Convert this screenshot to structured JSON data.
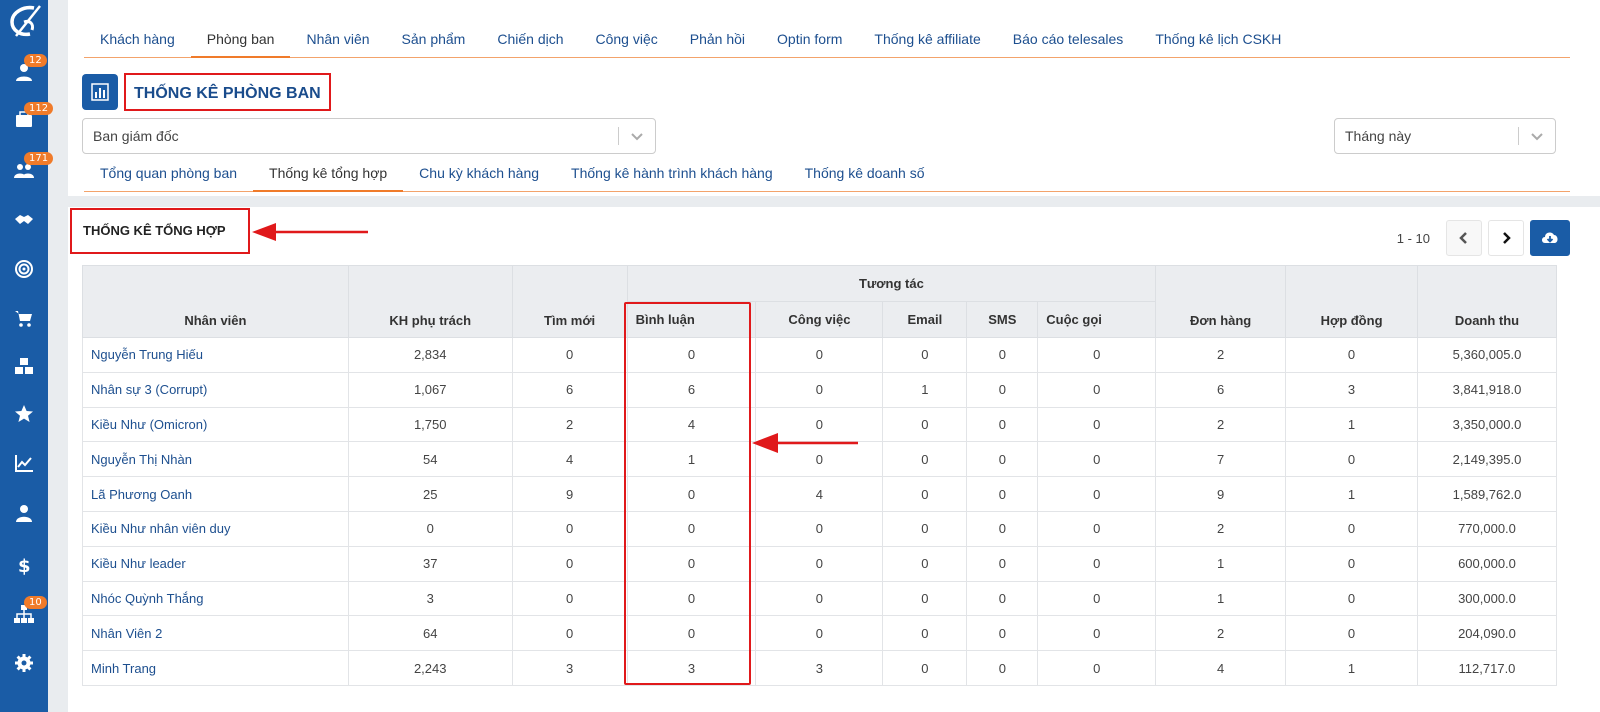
{
  "sidebar": {
    "badges": {
      "contacts": "12",
      "inbox": "112",
      "groups": "171",
      "org": "10"
    }
  },
  "tabs": [
    "Khách hàng",
    "Phòng ban",
    "Nhân viên",
    "Sản phẩm",
    "Chiến dịch",
    "Công việc",
    "Phản hồi",
    "Optin form",
    "Thống kê affiliate",
    "Báo cáo telesales",
    "Thống kê lịch CSKH"
  ],
  "active_tab": 1,
  "page_title": "THỐNG KÊ PHÒNG BAN",
  "department_select": "Ban giám đốc",
  "period_select": "Tháng này",
  "subtabs": [
    "Tổng quan phòng ban",
    "Thống kê tổng hợp",
    "Chu kỳ khách hàng",
    "Thống kê hành trình khách hàng",
    "Thống kê doanh số"
  ],
  "active_subtab": 1,
  "section_title": "THỐNG KÊ TỔNG HỢP",
  "pager": {
    "range": "1 - 10"
  },
  "table": {
    "group_header": "Tương tác",
    "headers": {
      "name": "Nhân viên",
      "kh": "KH phụ trách",
      "new": "Tìm mới",
      "comment": "Bình luận",
      "task": "Công việc",
      "email": "Email",
      "sms": "SMS",
      "call": "Cuộc gọi",
      "orders": "Đơn hàng",
      "contracts": "Hợp đồng",
      "revenue": "Doanh thu"
    },
    "rows": [
      [
        "Nguyễn Trung Hiếu",
        "2,834",
        "0",
        "0",
        "0",
        "0",
        "0",
        "0",
        "2",
        "0",
        "5,360,005.0"
      ],
      [
        "Nhân sự 3 (Corrupt)",
        "1,067",
        "6",
        "6",
        "0",
        "1",
        "0",
        "0",
        "6",
        "3",
        "3,841,918.0"
      ],
      [
        "Kiều Như (Omicron)",
        "1,750",
        "2",
        "4",
        "0",
        "0",
        "0",
        "0",
        "2",
        "1",
        "3,350,000.0"
      ],
      [
        "Nguyễn Thị Nhàn",
        "54",
        "4",
        "1",
        "0",
        "0",
        "0",
        "0",
        "7",
        "0",
        "2,149,395.0"
      ],
      [
        "Lã Phương Oanh",
        "25",
        "9",
        "0",
        "4",
        "0",
        "0",
        "0",
        "9",
        "1",
        "1,589,762.0"
      ],
      [
        "Kiều Như nhân viên duy",
        "0",
        "0",
        "0",
        "0",
        "0",
        "0",
        "0",
        "2",
        "0",
        "770,000.0"
      ],
      [
        "Kiều Như leader",
        "37",
        "0",
        "0",
        "0",
        "0",
        "0",
        "0",
        "1",
        "0",
        "600,000.0"
      ],
      [
        "Nhóc Quỳnh Thắng",
        "3",
        "0",
        "0",
        "0",
        "0",
        "0",
        "0",
        "1",
        "0",
        "300,000.0"
      ],
      [
        "Nhân Viên 2",
        "64",
        "0",
        "0",
        "0",
        "0",
        "0",
        "0",
        "2",
        "0",
        "204,090.0"
      ],
      [
        "Minh Trang",
        "2,243",
        "3",
        "3",
        "3",
        "0",
        "0",
        "0",
        "4",
        "1",
        "112,717.0"
      ]
    ]
  },
  "colors": {
    "brand": "#1a5ca6",
    "accent": "#f07b2a",
    "annotation": "#e0191b"
  }
}
